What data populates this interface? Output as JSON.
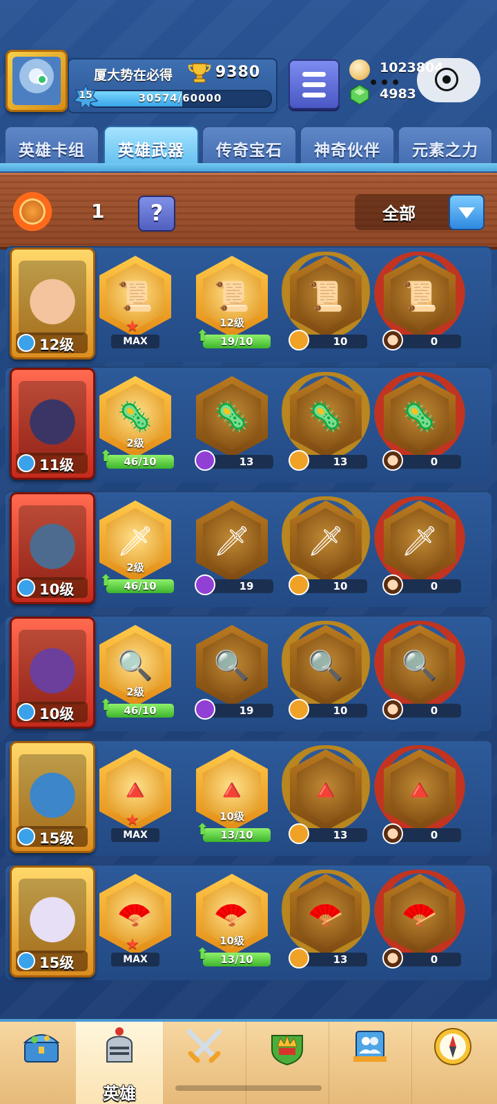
{
  "player": {
    "name": "厦大势在必得",
    "trophies": "9380",
    "level": "15",
    "xp_text": "30574/60000",
    "xp_fraction": 0.51
  },
  "currency": {
    "coins": "1023804",
    "gems": "4983"
  },
  "tabs": [
    {
      "label": "英雄卡组",
      "active": false
    },
    {
      "label": "英雄武器",
      "active": true
    },
    {
      "label": "传奇宝石",
      "active": false
    },
    {
      "label": "神奇伙伴",
      "active": false
    },
    {
      "label": "元素之力",
      "active": false
    }
  ],
  "toolbar": {
    "fire_count": "1",
    "help_label": "?",
    "filter_label": "全部"
  },
  "heroes": [
    {
      "level": "12级",
      "card": "gold",
      "face": "#f3c49e",
      "item_icon": "📜",
      "slot1": {
        "type": "max",
        "label": "MAX"
      },
      "slot2": {
        "level": "12级",
        "progress": "19/10",
        "fraction": 1.0
      },
      "slot3": {
        "cost": "10",
        "icon": "orange"
      },
      "slot4": {
        "cost": "0",
        "icon": "hero"
      }
    },
    {
      "level": "11级",
      "card": "red",
      "face": "#3b3566",
      "item_icon": "🦠",
      "slot1": {
        "type": "progress",
        "level": "2级",
        "progress": "46/10",
        "fraction": 1.0
      },
      "slot2": {
        "cost": "13",
        "icon": "purple"
      },
      "slot3": {
        "cost": "13",
        "icon": "orange"
      },
      "slot4": {
        "cost": "0",
        "icon": "hero"
      }
    },
    {
      "level": "10级",
      "card": "red",
      "face": "#4d6b8e",
      "item_icon": "🗡",
      "slot1": {
        "type": "progress",
        "level": "2级",
        "progress": "46/10",
        "fraction": 1.0
      },
      "slot2": {
        "cost": "19",
        "icon": "purple"
      },
      "slot3": {
        "cost": "10",
        "icon": "orange"
      },
      "slot4": {
        "cost": "0",
        "icon": "hero"
      }
    },
    {
      "level": "10级",
      "card": "red",
      "face": "#6b3f9b",
      "item_icon": "🔍",
      "slot1": {
        "type": "progress",
        "level": "2级",
        "progress": "46/10",
        "fraction": 1.0
      },
      "slot2": {
        "cost": "19",
        "icon": "purple"
      },
      "slot3": {
        "cost": "10",
        "icon": "orange"
      },
      "slot4": {
        "cost": "0",
        "icon": "hero"
      }
    },
    {
      "level": "15级",
      "card": "gold",
      "face": "#3d86c9",
      "item_icon": "🔺",
      "slot1": {
        "type": "max",
        "label": "MAX"
      },
      "slot2": {
        "level": "10级",
        "progress": "13/10",
        "fraction": 1.0
      },
      "slot3": {
        "cost": "13",
        "icon": "orange"
      },
      "slot4": {
        "cost": "0",
        "icon": "hero"
      }
    },
    {
      "level": "15级",
      "card": "gold",
      "face": "#e6dff5",
      "item_icon": "🪭",
      "slot1": {
        "type": "max",
        "label": "MAX"
      },
      "slot2": {
        "level": "10级",
        "progress": "13/10",
        "fraction": 1.0
      },
      "slot3": {
        "cost": "13",
        "icon": "orange"
      },
      "slot4": {
        "cost": "0",
        "icon": "hero"
      }
    }
  ],
  "bottom_nav": [
    {
      "icon": "treasure-chest-icon",
      "label": "",
      "active": false
    },
    {
      "icon": "knight-helmet-icon",
      "label": "英雄",
      "active": true
    },
    {
      "icon": "crossed-swords-icon",
      "label": "",
      "active": false
    },
    {
      "icon": "crown-shield-icon",
      "label": "",
      "active": false
    },
    {
      "icon": "team-banner-icon",
      "label": "",
      "active": false
    },
    {
      "icon": "compass-icon",
      "label": "",
      "active": false
    }
  ],
  "colors": {
    "accent": "#66c1ef",
    "progress_green": "#3db42c",
    "background": "#21467f"
  }
}
